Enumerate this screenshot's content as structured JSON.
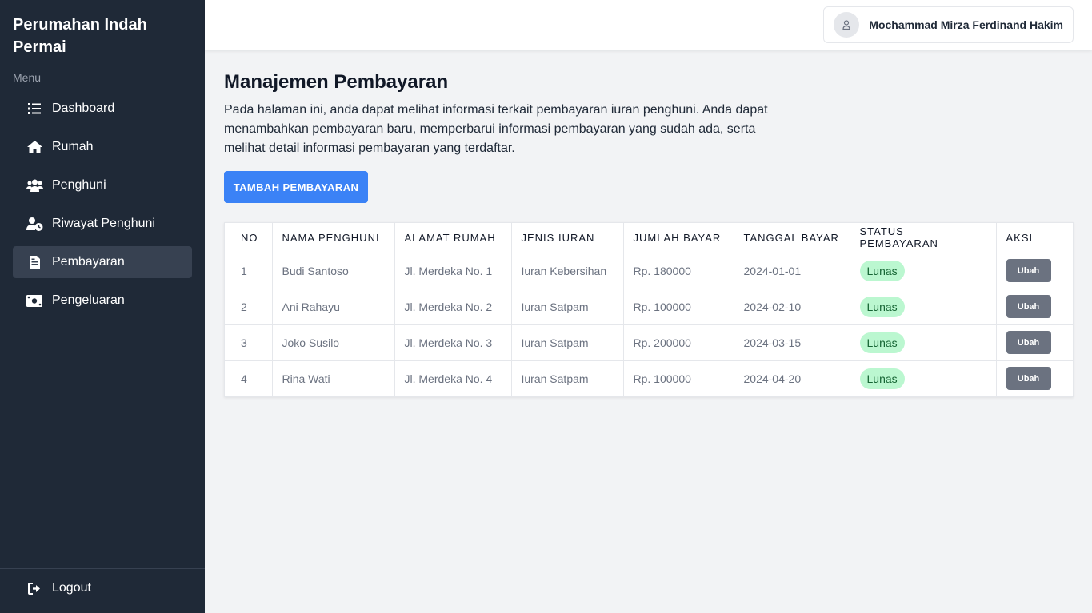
{
  "sidebar": {
    "brand": "Perumahan Indah Permai",
    "menu_label": "Menu",
    "items": [
      {
        "label": "Dashboard",
        "icon": "list-icon"
      },
      {
        "label": "Rumah",
        "icon": "home-icon"
      },
      {
        "label": "Penghuni",
        "icon": "users-icon"
      },
      {
        "label": "Riwayat Penghuni",
        "icon": "user-clock-icon"
      },
      {
        "label": "Pembayaran",
        "icon": "file-invoice-icon",
        "active": true
      },
      {
        "label": "Pengeluaran",
        "icon": "money-icon"
      }
    ],
    "logout": "Logout"
  },
  "header": {
    "user_name": "Mochammad Mirza Ferdinand Hakim"
  },
  "main": {
    "title": "Manajemen Pembayaran",
    "description": "Pada halaman ini, anda dapat melihat informasi terkait pembayaran iuran penghuni. Anda dapat menambahkan pembayaran baru, memperbarui informasi pembayaran yang sudah ada, serta melihat detail informasi pembayaran yang terdaftar.",
    "add_button": "TAMBAH PEMBAYARAN"
  },
  "table": {
    "columns": [
      "NO",
      "NAMA PENGHUNI",
      "ALAMAT RUMAH",
      "JENIS IURAN",
      "JUMLAH BAYAR",
      "TANGGAL BAYAR",
      "STATUS PEMBAYARAN",
      "AKSI"
    ],
    "rows": [
      {
        "no": "1",
        "name": "Budi Santoso",
        "address": "Jl. Merdeka No. 1",
        "type": "Iuran Kebersihan",
        "amount": "Rp. 180000",
        "date": "2024-01-01",
        "status": "Lunas",
        "action": "Ubah"
      },
      {
        "no": "2",
        "name": "Ani Rahayu",
        "address": "Jl. Merdeka No. 2",
        "type": "Iuran Satpam",
        "amount": "Rp. 100000",
        "date": "2024-02-10",
        "status": "Lunas",
        "action": "Ubah"
      },
      {
        "no": "3",
        "name": "Joko Susilo",
        "address": "Jl. Merdeka No. 3",
        "type": "Iuran Satpam",
        "amount": "Rp. 200000",
        "date": "2024-03-15",
        "status": "Lunas",
        "action": "Ubah"
      },
      {
        "no": "4",
        "name": "Rina Wati",
        "address": "Jl. Merdeka No. 4",
        "type": "Iuran Satpam",
        "amount": "Rp. 100000",
        "date": "2024-04-20",
        "status": "Lunas",
        "action": "Ubah"
      }
    ]
  },
  "colors": {
    "sidebar_bg": "#1f2937",
    "active_item_bg": "#374151",
    "primary": "#3b82f6",
    "badge_bg": "#bbf7d0",
    "edit_button_bg": "#6b7280"
  }
}
